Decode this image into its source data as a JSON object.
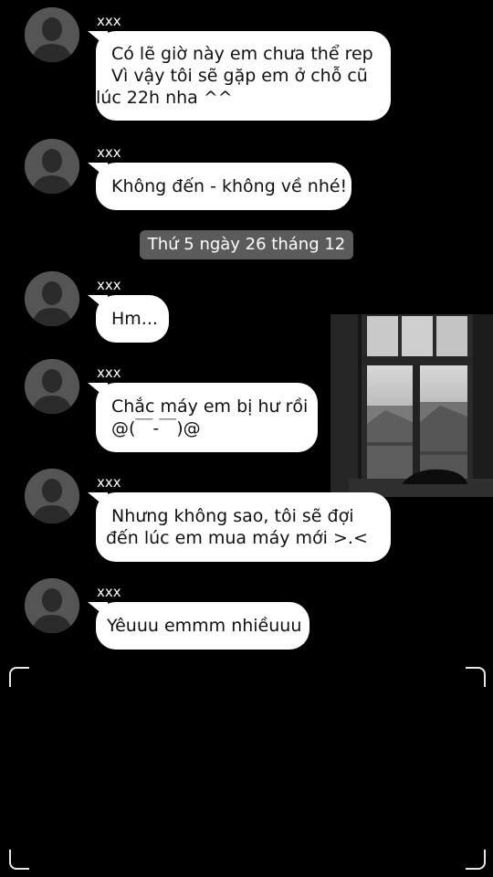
{
  "background_color": "#000000",
  "bubble_color": "#ffffff",
  "date_separator": {
    "text": "Thứ 5 ngày 26 tháng 12",
    "color": "#5b5b5b"
  },
  "messages": [
    {
      "sender": "xxx",
      "avatar_icon": "person-silhouette-icon",
      "lines": [
        "Có lẽ giờ này em chưa thể rep",
        "Vì vậy tôi sẽ gặp em ở chỗ cũ",
        "lúc 22h nha ^^"
      ]
    },
    {
      "sender": "xxx",
      "avatar_icon": "person-silhouette-icon",
      "lines": [
        "Không đến - không về nhé!"
      ]
    },
    {
      "sender": "xxx",
      "avatar_icon": "person-silhouette-icon",
      "lines": [
        "Hm..."
      ]
    },
    {
      "sender": "xxx",
      "avatar_icon": "person-silhouette-icon",
      "lines": [
        "Chắc máy em bị hư rồi",
        "@(￣-￣)@"
      ]
    },
    {
      "sender": "xxx",
      "avatar_icon": "person-silhouette-icon",
      "lines": [
        "Nhưng không sao, tôi sẽ đợi",
        "đến lúc em mua máy mới >.<"
      ]
    },
    {
      "sender": "xxx",
      "avatar_icon": "person-silhouette-icon",
      "lines": [
        "Yêuuu emmm nhiềuuu"
      ]
    }
  ],
  "background_image": {
    "icon": "window-photo-icon"
  },
  "viewfinder": {
    "icon": "camera-frame-corners-icon"
  }
}
